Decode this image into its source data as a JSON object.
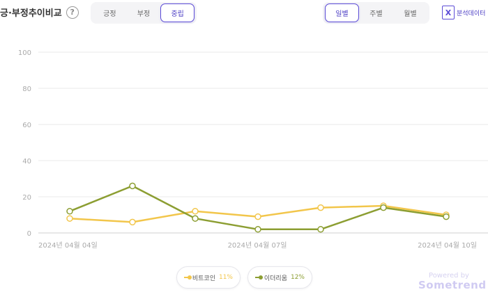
{
  "header": {
    "title": "긍·부정추이비교",
    "help_icon": "?",
    "sentiment_tabs": [
      {
        "label": "긍정",
        "active": false
      },
      {
        "label": "부정",
        "active": false
      },
      {
        "label": "중립",
        "active": true
      }
    ],
    "period_tabs": [
      {
        "label": "일별",
        "active": true
      },
      {
        "label": "주별",
        "active": false
      },
      {
        "label": "월별",
        "active": false
      }
    ],
    "export_icon": "X",
    "export_label": "분석데이터"
  },
  "colors": {
    "accent": "#5b4bd6",
    "series_1": "#f2c64b",
    "series_2": "#8c9e32"
  },
  "chart_data": {
    "type": "line",
    "title": "",
    "xlabel": "",
    "ylabel": "",
    "x": [
      "2024년 04월 04일",
      "2024년 04월 05일",
      "2024년 04월 06일",
      "2024년 04월 07일",
      "2024년 04월 08일",
      "2024년 04월 09일",
      "2024년 04월 10일"
    ],
    "x_tick_labels": [
      "2024년 04월 04일",
      "2024년 04월 07일",
      "2024년 04월 10일"
    ],
    "ylim": [
      0,
      100
    ],
    "y_ticks": [
      "100",
      "80",
      "60",
      "40",
      "20",
      "0"
    ],
    "grid": true,
    "legend_position": "bottom-center",
    "series": [
      {
        "name": "비트코인",
        "pct": "11%",
        "values": [
          8,
          6,
          12,
          9,
          14,
          15,
          10
        ]
      },
      {
        "name": "이더리움",
        "pct": "12%",
        "values": [
          12,
          26,
          8,
          2,
          2,
          14,
          9
        ]
      }
    ]
  },
  "footer": {
    "powered_by": "Powered by",
    "brand": "Sometrend"
  }
}
